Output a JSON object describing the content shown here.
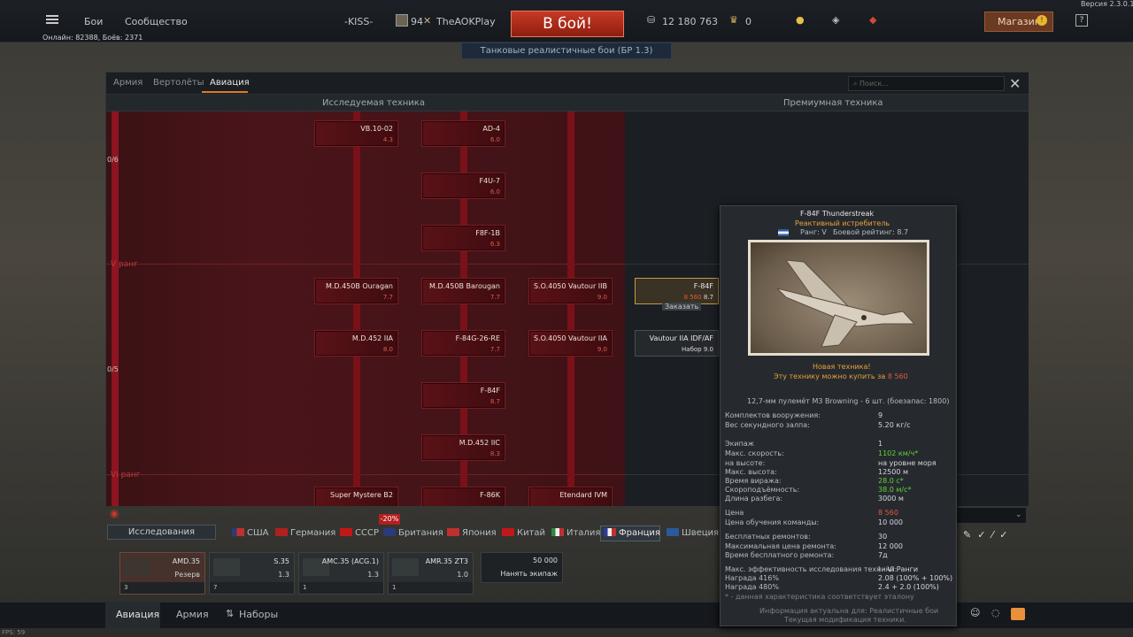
{
  "version": "Версия 2.3.0.15",
  "online": "Онлайн: 82388, Боёв: 2371",
  "topbar": {
    "menu": [
      "Бои",
      "Сообщество"
    ],
    "squad": "-KISS-",
    "player_level": "94",
    "player_name": "TheAOKPlay",
    "battle_button": "В бой!",
    "battle_mode": "Танковые реалистичные бои (БР 1.3)",
    "silver": "12 180 763",
    "gold": "0",
    "shop": "Магазин"
  },
  "tabs": [
    "Армия",
    "Вертолёты",
    "Авиация"
  ],
  "search_placeholder": "Поиск...",
  "sections": {
    "research": "Исследуемая техника",
    "premium": "Премиумная техника"
  },
  "side_counts": [
    "0/6",
    "0/5"
  ],
  "ranks": [
    "V ранг",
    "VI ранг"
  ],
  "tree": [
    {
      "name": "VB.10-02",
      "br": "4.3"
    },
    {
      "name": "AD-4",
      "br": "6.0"
    },
    {
      "name": "F4U-7",
      "br": "6.0"
    },
    {
      "name": "F8F-1B",
      "br": "6.3"
    },
    {
      "name": "M.D.450B Ouragan",
      "br": "7.7"
    },
    {
      "name": "M.D.450B Barougan",
      "br": "7.7"
    },
    {
      "name": "S.O.4050 Vautour IIB",
      "br": "9.0"
    },
    {
      "name": "M.D.452 IIA",
      "br": "8.0"
    },
    {
      "name": "F-84G-26-RE",
      "br": "7.7"
    },
    {
      "name": "S.O.4050 Vautour IIA",
      "br": "9.0"
    },
    {
      "name": "F-84F",
      "br": "8.7"
    },
    {
      "name": "M.D.452 IIC",
      "br": "8.3"
    },
    {
      "name": "Super Mystere B2",
      "br": ""
    },
    {
      "name": "F-86K",
      "br": ""
    },
    {
      "name": "Etendard IVM",
      "br": ""
    }
  ],
  "premium": [
    {
      "name": "F-84F",
      "price": "8 560",
      "br": "8.7",
      "order": "Заказать"
    },
    {
      "name": "Vautour IIA IDF/AF",
      "label": "Набор",
      "br": "9.0"
    }
  ],
  "tooltip": {
    "title": "F-84F Thunderstreak",
    "class": "Реактивный истребитель",
    "rank": "Ранг: V",
    "br": "Боевой рейтинг: 8.7",
    "new": "Новая техника!",
    "buy_pre": "Эту технику можно купить за",
    "buy_price": "8 560",
    "weapon": "12,7-мм пулемёт M3 Browning - 6 шт. (боезапас: 1800)",
    "stats": [
      {
        "l": "Комплектов вооружения:",
        "v": "9",
        "c": "tv"
      },
      {
        "l": "Вес секундного залпа:",
        "v": "5.20 кг/с",
        "c": "tv"
      },
      {
        "l": "Экипаж",
        "v": "1",
        "c": "tv"
      },
      {
        "l": "Макс. скорость:",
        "v": "1102 км/ч*",
        "c": "tg"
      },
      {
        "l": "на высоте:",
        "v": "на уровне моря",
        "c": "tv"
      },
      {
        "l": "Макс. высота:",
        "v": "12500 м",
        "c": "tv"
      },
      {
        "l": "Время виража:",
        "v": "28.0 с*",
        "c": "tg"
      },
      {
        "l": "Скороподъёмность:",
        "v": "38.0 м/с*",
        "c": "tg"
      },
      {
        "l": "Длина разбега:",
        "v": "3000 м",
        "c": "tv"
      },
      {
        "l": "Цена",
        "v": "8 560",
        "c": "to"
      },
      {
        "l": "Цена обучения команды:",
        "v": "10 000",
        "c": "tv"
      },
      {
        "l": "Бесплатных ремонтов:",
        "v": "30",
        "c": "tv"
      },
      {
        "l": "Максимальная цена ремонта:",
        "v": "12 000",
        "c": "tv"
      },
      {
        "l": "Время бесплатного ремонта:",
        "v": "7д",
        "c": "tv"
      },
      {
        "l": "Макс. эффективность исследования техники:",
        "v": "I - VI Ранги",
        "c": "tv"
      },
      {
        "l": "Награда 416%",
        "v": "2.08 (100% + 100%)",
        "c": "tv"
      },
      {
        "l": "Награда 480%",
        "v": "2.4 + 2.0 (100%)",
        "c": "tv"
      }
    ],
    "note": "* - данная характеристика соответствует эталону",
    "footer1": "Информация актуальна для: Реалистичные бои",
    "footer2": "Текущая модификация техники."
  },
  "research_button": "Исследования",
  "discount": "-20%",
  "nations": [
    "США",
    "Германия",
    "СССР",
    "Британия",
    "Япония",
    "Китай",
    "Италия",
    "Франция",
    "Швеция"
  ],
  "slots": [
    {
      "name": "AMD.35",
      "br": "Резерв",
      "crew": "3"
    },
    {
      "name": "S.35",
      "br": "1.3",
      "crew": "7"
    },
    {
      "name": "AMC.35 (ACG.1)",
      "br": "1.3",
      "crew": "1"
    },
    {
      "name": "AMR.35 ZT3",
      "br": "1.0",
      "crew": "1"
    }
  ],
  "crew_hire": {
    "price": "50 000",
    "label": "Нанять экипаж"
  },
  "bottom": [
    "Авиация",
    "Армия",
    "Наборы"
  ],
  "fps": "FPS: 59"
}
